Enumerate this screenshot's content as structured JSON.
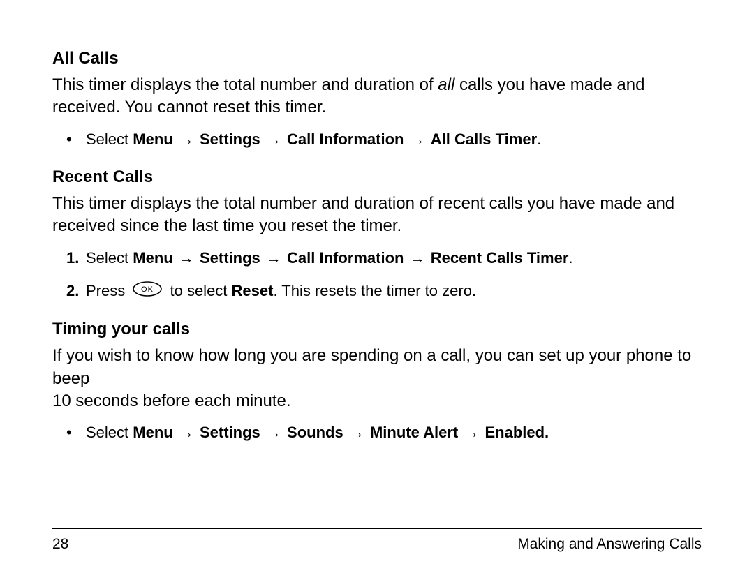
{
  "sections": {
    "allCalls": {
      "heading": "All Calls",
      "body_pre": "This timer displays the total number and duration of ",
      "body_italic": "all",
      "body_post": " calls you have made and received. You cannot reset this timer.",
      "bullet_prefix": "Select ",
      "bullet_path_1": "Menu",
      "bullet_path_2": "Settings",
      "bullet_path_3": "Call Information",
      "bullet_path_4": "All Calls Timer",
      "bullet_period": "."
    },
    "recentCalls": {
      "heading": "Recent Calls",
      "body": "This timer displays the total number and duration of recent calls you have made and received since the last time you reset the timer.",
      "step1_marker": "1.",
      "step1_prefix": "Select ",
      "step1_path_1": "Menu",
      "step1_path_2": "Settings",
      "step1_path_3": "Call Information",
      "step1_path_4": "Recent Calls Timer",
      "step1_period": ".",
      "step2_marker": "2.",
      "step2_pre": "Press ",
      "step2_mid": " to select ",
      "step2_bold": "Reset",
      "step2_post": ". This resets the timer to zero."
    },
    "timing": {
      "heading": "Timing your calls",
      "body_line1": "If you wish to know how long you are spending on a call, you can set up your phone to beep",
      "body_line2": "10 seconds before each minute.",
      "bullet_prefix": "Select ",
      "bullet_path_1": "Menu",
      "bullet_path_2": "Settings",
      "bullet_path_3": "Sounds",
      "bullet_path_4": "Minute Alert",
      "bullet_path_5": "Enabled.",
      "bullet_marker": "•"
    }
  },
  "symbols": {
    "arrow": "→",
    "bullet": "•"
  },
  "footer": {
    "page_number": "28",
    "chapter": "Making and Answering Calls"
  }
}
